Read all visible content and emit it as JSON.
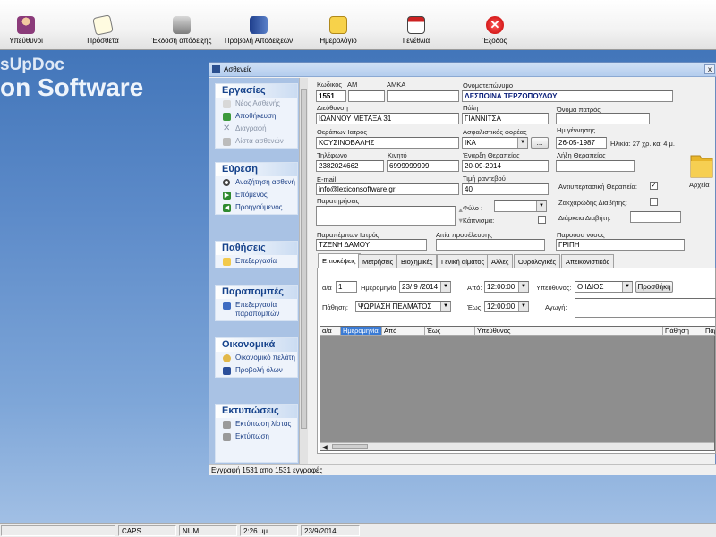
{
  "toolbar": {
    "items": [
      {
        "label": "Υπεύθυνοι",
        "icon": "person-icon"
      },
      {
        "label": "Πρόσθετα",
        "icon": "notepad-icon"
      },
      {
        "label": "Έκδοση απόδειξης",
        "icon": "printer-icon"
      },
      {
        "label": "Προβολή Αποδείξεων",
        "icon": "book-icon"
      },
      {
        "label": "Ημερολόγιο",
        "icon": "calendar-icon"
      },
      {
        "label": "Γενέθλια",
        "icon": "birthday-calendar-icon"
      },
      {
        "label": "Έξοδος",
        "icon": "exit-icon"
      }
    ]
  },
  "brand": {
    "line1": "sUpDoc",
    "line2": "on Software"
  },
  "window": {
    "title": "Ασθενείς",
    "close_label": "x",
    "status": "Εγγραφή 1531 απο 1531 εγγραφές"
  },
  "nav": {
    "groups": [
      {
        "title": "Εργασίες",
        "items": [
          {
            "label": "Νέος Ασθενής",
            "icon": "new-document-icon",
            "disabled": true
          },
          {
            "label": "Αποθήκευση",
            "icon": "save-icon",
            "disabled": false
          },
          {
            "label": "Διαγραφή",
            "icon": "delete-icon",
            "disabled": true
          },
          {
            "label": "Λίστα ασθενών",
            "icon": "list-icon",
            "disabled": true
          }
        ]
      },
      {
        "title": "Εύρεση",
        "items": [
          {
            "label": "Αναζήτηση ασθενή",
            "icon": "search-icon"
          },
          {
            "label": "Επόμενος",
            "icon": "next-arrow-icon"
          },
          {
            "label": "Προηγούμενος",
            "icon": "previous-arrow-icon"
          }
        ]
      },
      {
        "title": "Παθήσεις",
        "items": [
          {
            "label": "Επεξεργασία",
            "icon": "folder-icon"
          }
        ]
      },
      {
        "title": "Παραπομπές",
        "items": [
          {
            "label": "Επεξεργασία παραπομπών",
            "icon": "referral-icon"
          }
        ]
      },
      {
        "title": "Οικονομικά",
        "items": [
          {
            "label": "Οικονομικό πελάτη",
            "icon": "coins-icon"
          },
          {
            "label": "Προβολή όλων",
            "icon": "book-icon"
          }
        ]
      },
      {
        "title": "Εκτυπώσεις",
        "items": [
          {
            "label": "Εκτύπωση λίστας",
            "icon": "printer-icon"
          },
          {
            "label": "Εκτύπωση",
            "icon": "printer-icon"
          }
        ]
      }
    ]
  },
  "form": {
    "code_label": "Κωδικός",
    "code": "1551",
    "am_label": "ΑΜ",
    "am": "",
    "amka_label": "ΑΜΚΑ",
    "amka": "",
    "name_label": "Ονοματεπώνυμο",
    "name": "ΔΕΣΠΟΙΝΑ ΤΕΡΖΟΠΟΥΛΟΥ",
    "address_label": "Διεύθυνση",
    "address": "ΙΩΑΝΝΟΥ ΜΕΤΑΞΑ 31",
    "city_label": "Πόλη",
    "city": "ΓΙΑΝΝΙΤΣΑ",
    "father_label": "Όνομα πατρός",
    "father": "",
    "doctor_label": "Θεράπων Ιατρός",
    "doctor": "ΚΟΥΣΙΝΟΒΑΛΗΣ",
    "insurance_label": "Ασφαλιστικός φορέας",
    "insurance": "ΙΚΑ",
    "insurance_btn": "...",
    "birth_label": "Ημ γέννησης",
    "birth": "26-05-1987",
    "age": "Ηλικία:  27 χρ. και 4 μ.",
    "phone_label": "Τηλέφωνο",
    "phone": "2382024662",
    "mobile_label": "Κινητό",
    "mobile": "6999999999",
    "start_label": "Έναρξη Θεραπείας",
    "start": "20-09-2014",
    "end_label": "Λήξη Θεραπείας",
    "end": "",
    "email_label": "E-mail",
    "email": "info@lexiconsoftware.gr",
    "price_label": "Τιμή ραντεβού",
    "price": "40",
    "notes_label": "Παρατηρήσεις",
    "notes": "",
    "gender_label": "Φύλο :",
    "gender": "",
    "smoking_label": "Κάπνισμα:",
    "hypertension_label": "Αντιυπερτασική Θεραπεία:",
    "hypertension_checked": "✓",
    "diabetes_label": "Ζακχαρώδης Διαβήτης:",
    "diabetes_duration_label": "Διάρκεια Διαβήτη:",
    "diabetes_duration": "",
    "ref_doctor_label": "Παραπέμπων Ιατρός",
    "ref_doctor": "ΤΖΕΝΗ ΔΑΜΟΥ",
    "reason_label": "Αιτία προσέλευσης",
    "reason": "",
    "disease_label": "Παρούσα νόσος",
    "disease": "ΓΡΙΠΗ",
    "archive_label": "Αρχεία"
  },
  "tabs": [
    {
      "label": "Επισκέψεις",
      "active": true
    },
    {
      "label": "Μετρήσεις"
    },
    {
      "label": "Βιοχημικές"
    },
    {
      "label": "Γενική αίματος"
    },
    {
      "label": "Άλλες"
    },
    {
      "label": "Ουρολογικές"
    },
    {
      "label": "Απεικονιστικός"
    }
  ],
  "visit": {
    "aa_label": "α/α",
    "aa": "1",
    "date_label": "Ημερομηνία",
    "date": "23/ 9 /2014",
    "from_label": "Από:",
    "from": "12:00:00",
    "to_label": "Έως:",
    "to": "12:00:00",
    "resp_label": "Υπεύθυνος:",
    "resp": "Ο ΙΔΙΟΣ",
    "add_button": "Προσθήκη",
    "condition_label": "Πάθηση:",
    "condition": "ΨΩΡΙΑΣΗ ΠΕΛΜΑΤΟΣ",
    "treatment_label": "Αγωγή:",
    "treatment": ""
  },
  "grid": {
    "columns": [
      "α/α",
      "Ημερομηνία",
      "Από",
      "Έως",
      "Υπεύθυνος",
      "Πάθηση",
      "Παρ"
    ]
  },
  "statusbar": {
    "cells": [
      "",
      "CAPS",
      "NUM",
      "2:26 μμ",
      "23/9/2014"
    ]
  }
}
